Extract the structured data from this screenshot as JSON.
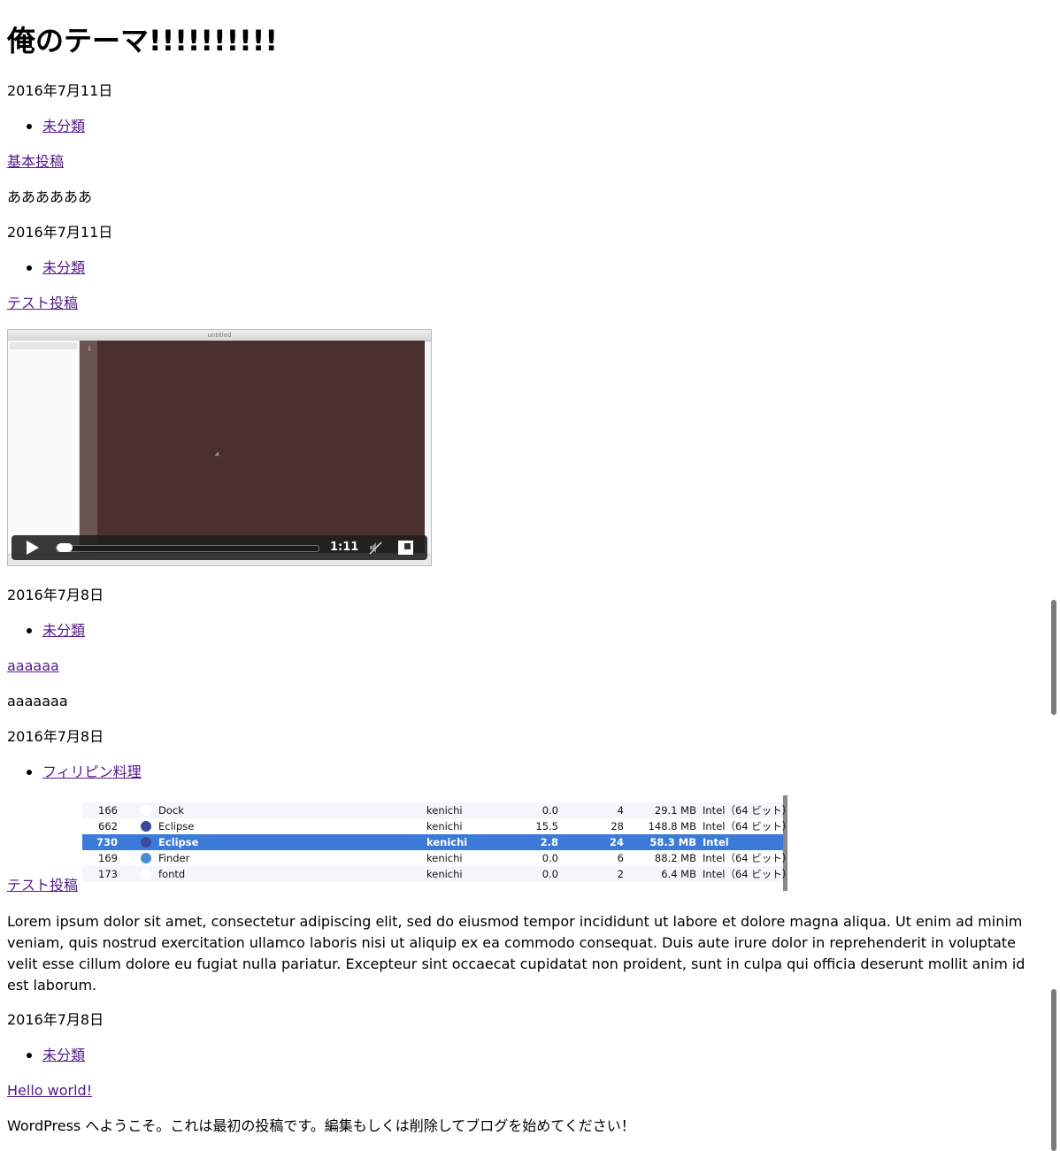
{
  "site": {
    "title": "俺のテーマ!!!!!!!!!!"
  },
  "posts": [
    {
      "date": "2016年7月11日",
      "category": "未分類",
      "title": "基本投稿",
      "excerpt": "ああああああ"
    },
    {
      "date": "2016年7月11日",
      "category": "未分類",
      "title": "テスト投稿",
      "video": {
        "window_title": "untitled",
        "duration": "1:11",
        "progress": 0
      }
    },
    {
      "date": "2016年7月8日",
      "category": "未分類",
      "title": "aaaaaa",
      "excerpt": "aaaaaaa"
    },
    {
      "date": "2016年7月8日",
      "category": "フィリピン料理",
      "title": "テスト投稿",
      "thumbnail_rows": [
        {
          "pid": "166",
          "name": "Dock",
          "user": "kenichi",
          "cpu": "0.0",
          "threads": "4",
          "mem": "29.1 MB",
          "kind": "Intel（64 ビット）",
          "icon_color": "#ffffff"
        },
        {
          "pid": "662",
          "name": "Eclipse",
          "user": "kenichi",
          "cpu": "15.5",
          "threads": "28",
          "mem": "148.8 MB",
          "kind": "Intel（64 ビット）",
          "icon_color": "#3a4a9a"
        },
        {
          "pid": "730",
          "name": "Eclipse",
          "user": "kenichi",
          "cpu": "2.8",
          "threads": "24",
          "mem": "58.3 MB",
          "kind": "Intel",
          "icon_color": "#3a4a9a"
        },
        {
          "pid": "169",
          "name": "Finder",
          "user": "kenichi",
          "cpu": "0.0",
          "threads": "6",
          "mem": "88.2 MB",
          "kind": "Intel（64 ビット）",
          "icon_color": "#4a8bd6"
        },
        {
          "pid": "173",
          "name": "fontd",
          "user": "kenichi",
          "cpu": "0.0",
          "threads": "2",
          "mem": "6.4 MB",
          "kind": "Intel（64 ビット）",
          "icon_color": "#ffffff"
        }
      ],
      "body": "Lorem ipsum dolor sit amet, consectetur adipiscing elit, sed do eiusmod tempor incididunt ut labore et dolore magna aliqua. Ut enim ad minim veniam, quis nostrud exercitation ullamco laboris nisi ut aliquip ex ea commodo consequat. Duis aute irure dolor in reprehenderit in voluptate velit esse cillum dolore eu fugiat nulla pariatur. Excepteur sint occaecat cupidatat non proident, sunt in culpa qui officia deserunt mollit anim id est laborum."
    },
    {
      "date": "2016年7月8日",
      "category": "未分類",
      "title": "Hello world!",
      "excerpt": "WordPress へようこそ。これは最初の投稿です。編集もしくは削除してブログを始めてください！"
    }
  ],
  "colors": {
    "link": "#551a8b",
    "selected_row": "#3b7ad9",
    "editor_bg": "#4a3130"
  }
}
